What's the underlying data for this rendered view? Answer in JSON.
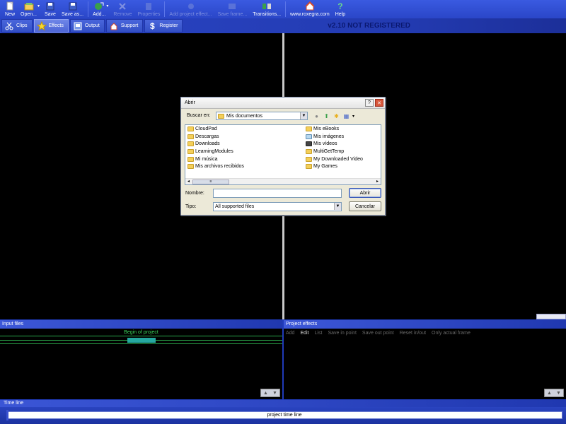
{
  "toolbar": {
    "new": "New",
    "open": "Open...",
    "save": "Save",
    "save_as": "Save as...",
    "add": "Add...",
    "remove": "Remove",
    "properties": "Properties",
    "add_project_effect": "Add project effect...",
    "save_frame": "Save frame...",
    "transitions": "Transitions...",
    "website": "www.roxegra.com",
    "help": "Help"
  },
  "tabs": [
    {
      "label": "Clips",
      "icon": "scissors-icon"
    },
    {
      "label": "Effects",
      "icon": "star-icon"
    },
    {
      "label": "Output",
      "icon": "output-icon"
    },
    {
      "label": "Support",
      "icon": "home-icon"
    },
    {
      "label": "Register",
      "icon": "dollar-icon"
    }
  ],
  "version": "v2.10 NOT REGISTERED",
  "panels": {
    "input_files": "Input files",
    "begin_of_project": "Begin of project",
    "project_effects": "Project effects",
    "effects_buttons": [
      "Add",
      "Edit",
      "List",
      "Save in point",
      "Save out point",
      "Reset in/out",
      "Only actual frame"
    ],
    "timeline": "Time line",
    "project_time_line": "project time line"
  },
  "dialog": {
    "title": "Abrir",
    "look_in_label": "Buscar en:",
    "look_in_value": "Mis documentos",
    "files_left": [
      "CloudPad",
      "Descargas",
      "Downloads",
      "LearningModules",
      "Mi música",
      "Mis archivos recibidos"
    ],
    "files_right": [
      "Mis eBooks",
      "Mis imágenes",
      "Mis vídeos",
      "MultiGetTemp",
      "My Downloaded Video",
      "My Games"
    ],
    "name_label": "Nombre:",
    "name_value": "",
    "type_label": "Tipo:",
    "type_value": "All supported files",
    "open_button": "Abrir",
    "cancel_button": "Cancelar"
  },
  "colors": {
    "toolbar_bg": "#3a5ae0",
    "preview_bg": "#000000",
    "timeline_green": "#2aa84a"
  }
}
